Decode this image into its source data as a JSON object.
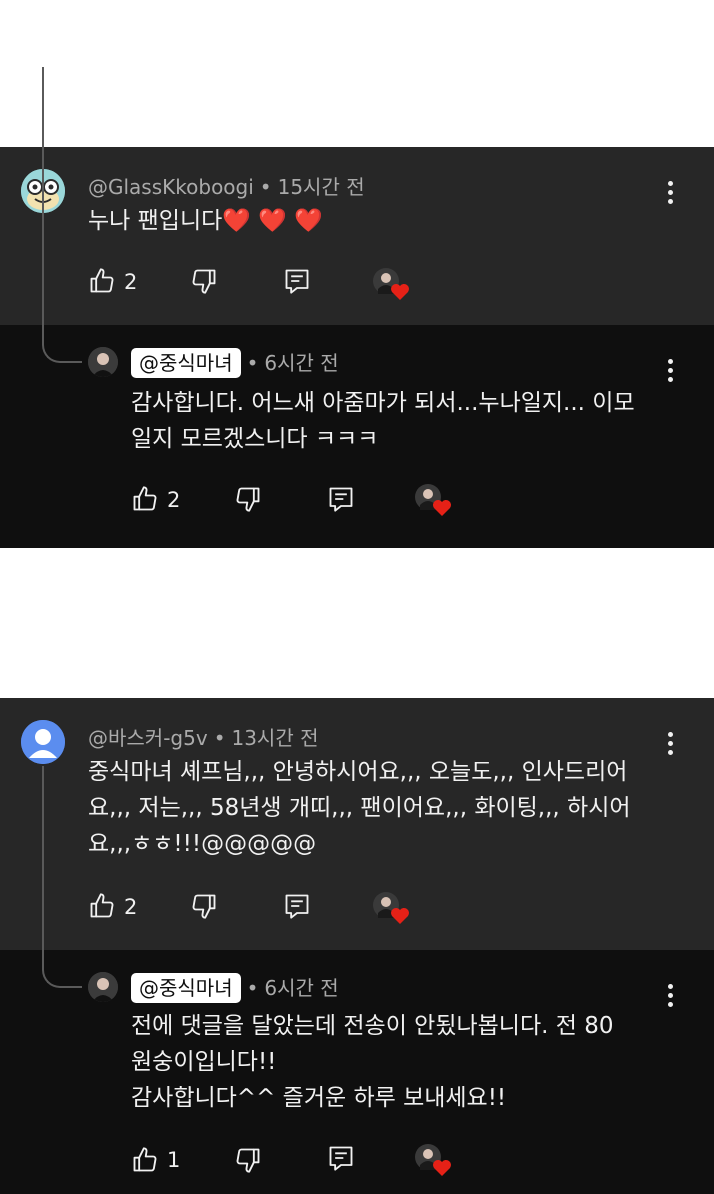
{
  "thread1": {
    "comment": {
      "author": "@GlassKkoboogi",
      "time": "15시간 전",
      "text": "누나 팬입니다❤️ ❤️ ❤️",
      "like_count": "2",
      "avatar_icon": "turtle-avatar-icon"
    },
    "reply": {
      "author": "@중식마녀",
      "time": "6시간 전",
      "lines": [
        "감사합니다. 어느새 아줌마가 되서...누나일지... 이모",
        "일지 모르겠스니다 ㅋㅋㅋ"
      ],
      "like_count": "2"
    }
  },
  "thread2": {
    "comment": {
      "author": "@바스커-g5v",
      "time": "13시간 전",
      "lines": [
        "중식마녀 셰프님,,, 안녕하시어요,,, 오늘도,,, 인사드리어",
        "요,,, 저는,,, 58년생 개띠,,, 팬이어요,,, 화이팅,,, 하시어",
        "요,,,ㅎㅎ!!!@@@@@"
      ],
      "like_count": "2",
      "avatar_icon": "default-person-avatar-icon"
    },
    "reply": {
      "author": "@중식마녀",
      "time": "6시간 전",
      "lines": [
        "전에 댓글을 달았는데 전송이 안됬나봅니다. 전 80",
        "원숭이입니다!!",
        "감사합니다^^ 즐거운 하루 보내세요!!"
      ],
      "like_count": "1"
    }
  },
  "colors": {
    "top_comment_bg": "#272727",
    "reply_bg": "#0f0f0f",
    "meta_text": "#aaaaaa",
    "body_text": "#f1f1f1",
    "heart": "#e62117"
  },
  "icons": [
    "thumbs-up-icon",
    "thumbs-down-icon",
    "reply-icon",
    "creator-heart-icon",
    "more-vert-icon"
  ]
}
